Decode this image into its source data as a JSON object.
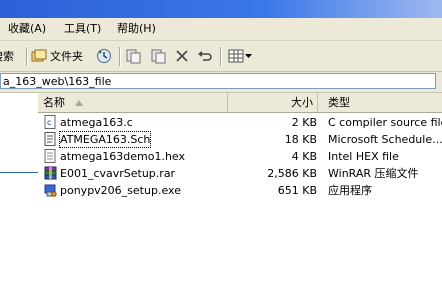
{
  "menu": {
    "favorites": "收藏(A)",
    "tools": "工具(T)",
    "help": "帮助(H)"
  },
  "toolbar": {
    "search_label": "搜索",
    "folders_label": "文件夹"
  },
  "address": {
    "path": "a_163_web\\163_file"
  },
  "columns": {
    "name": "名称",
    "size": "大小",
    "type": "类型"
  },
  "files": [
    {
      "name": "atmega163.c",
      "size": "2 KB",
      "type": "C compiler source file",
      "icon": "c-file-icon"
    },
    {
      "name": "ATMEGA163.Sch",
      "size": "18 KB",
      "type": "Microsoft Schedule...",
      "icon": "schedule-file-icon"
    },
    {
      "name": "atmega163demo1.hex",
      "size": "4 KB",
      "type": "Intel HEX file",
      "icon": "hex-file-icon"
    },
    {
      "name": "E001_cvavrSetup.rar",
      "size": "2,586 KB",
      "type": "WinRAR 压缩文件",
      "icon": "winrar-archive-icon"
    },
    {
      "name": "ponypv206_setup.exe",
      "size": "651 KB",
      "type": "应用程序",
      "icon": "setup-exe-icon"
    }
  ]
}
